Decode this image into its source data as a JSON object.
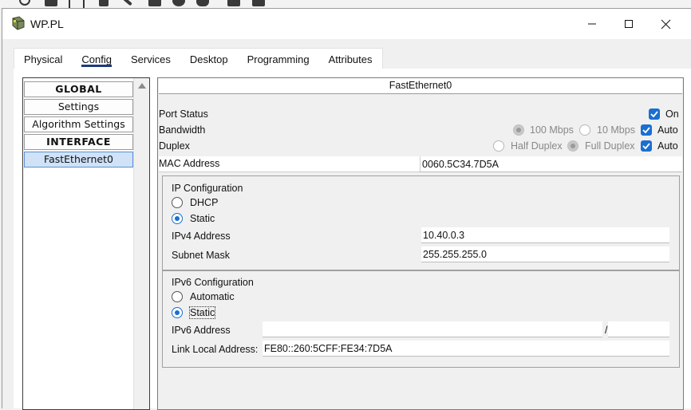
{
  "window": {
    "title": "WP.PL"
  },
  "tabs": [
    {
      "label": "Physical"
    },
    {
      "label": "Config"
    },
    {
      "label": "Services"
    },
    {
      "label": "Desktop"
    },
    {
      "label": "Programming"
    },
    {
      "label": "Attributes"
    }
  ],
  "active_tab": "Config",
  "sidebar": {
    "items": [
      {
        "label": "GLOBAL",
        "kind": "header"
      },
      {
        "label": "Settings",
        "kind": "item"
      },
      {
        "label": "Algorithm Settings",
        "kind": "item"
      },
      {
        "label": "INTERFACE",
        "kind": "header"
      },
      {
        "label": "FastEthernet0",
        "kind": "item",
        "selected": true
      }
    ]
  },
  "interface": {
    "title": "FastEthernet0",
    "port_status": {
      "label": "Port Status",
      "on_label": "On",
      "checked": true
    },
    "bandwidth": {
      "label": "Bandwidth",
      "opt1": "100 Mbps",
      "opt2": "10 Mbps",
      "auto_label": "Auto",
      "auto_checked": true
    },
    "duplex": {
      "label": "Duplex",
      "opt1": "Half Duplex",
      "opt2": "Full Duplex",
      "auto_label": "Auto",
      "auto_checked": true
    },
    "mac": {
      "label": "MAC Address",
      "value": "0060.5C34.7D5A"
    }
  },
  "ip_config": {
    "title": "IP Configuration",
    "dhcp_label": "DHCP",
    "static_label": "Static",
    "selected": "Static",
    "ipv4_label": "IPv4 Address",
    "ipv4_value": "10.40.0.3",
    "mask_label": "Subnet Mask",
    "mask_value": "255.255.255.0"
  },
  "ipv6_config": {
    "title": "IPv6 Configuration",
    "auto_label": "Automatic",
    "static_label": "Static",
    "selected": "Static",
    "addr_label": "IPv6 Address",
    "addr_value": "",
    "prefix_sep": "/",
    "prefix_value": "",
    "link_local_label": "Link Local Address:",
    "link_local_value": "FE80::260:5CFF:FE34:7D5A"
  },
  "colors": {
    "accent": "#1a6fd0",
    "tab_underline": "#1f3a7a",
    "selected_item": "#cfe2f8"
  }
}
